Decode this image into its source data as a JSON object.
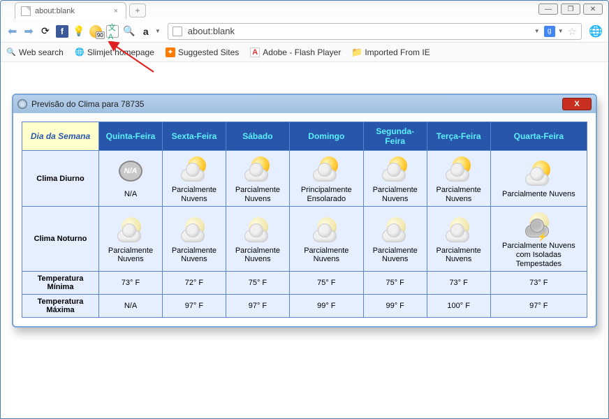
{
  "tab": {
    "title": "about:blank"
  },
  "address": {
    "value": "about:blank"
  },
  "toolbar": {
    "temp_badge": "90"
  },
  "bookmarks": [
    "Web search",
    "Slimjet homepage",
    "Suggested Sites",
    "Adobe - Flash Player",
    "Imported From IE"
  ],
  "popup": {
    "title": "Previsão do Clima para 78735",
    "headers": {
      "row_label": "Dia da Semana",
      "days": [
        "Quinta-Feira",
        "Sexta-Feira",
        "Sábado",
        "Domingo",
        "Segunda-Feira",
        "Terça-Feira",
        "Quarta-Feira"
      ]
    },
    "rows": {
      "day_label": "Clima Diurno",
      "night_label": "Clima Noturno",
      "min_label": "Temperatura Mínima",
      "max_label": "Temperatura Máxima"
    },
    "day": [
      {
        "icon": "na",
        "desc": "N/A"
      },
      {
        "icon": "partly",
        "desc": "Parcialmente Nuvens"
      },
      {
        "icon": "partly",
        "desc": "Parcialmente Nuvens"
      },
      {
        "icon": "partly",
        "desc": "Principalmente Ensolarado"
      },
      {
        "icon": "partly",
        "desc": "Parcialmente Nuvens"
      },
      {
        "icon": "partly",
        "desc": "Parcialmente Nuvens"
      },
      {
        "icon": "partly",
        "desc": "Parcialmente Nuvens"
      }
    ],
    "night": [
      {
        "icon": "night",
        "desc": "Parcialmente Nuvens"
      },
      {
        "icon": "night",
        "desc": "Parcialmente Nuvens"
      },
      {
        "icon": "night",
        "desc": "Parcialmente Nuvens"
      },
      {
        "icon": "night",
        "desc": "Parcialmente Nuvens"
      },
      {
        "icon": "night",
        "desc": "Parcialmente Nuvens"
      },
      {
        "icon": "night",
        "desc": "Parcialmente Nuvens"
      },
      {
        "icon": "storm",
        "desc": "Parcialmente Nuvens com Isoladas Tempestades"
      }
    ],
    "min": [
      "73° F",
      "72° F",
      "75° F",
      "75° F",
      "75° F",
      "73° F",
      "73° F"
    ],
    "max": [
      "N/A",
      "97° F",
      "97° F",
      "99° F",
      "99° F",
      "100° F",
      "97° F"
    ]
  }
}
